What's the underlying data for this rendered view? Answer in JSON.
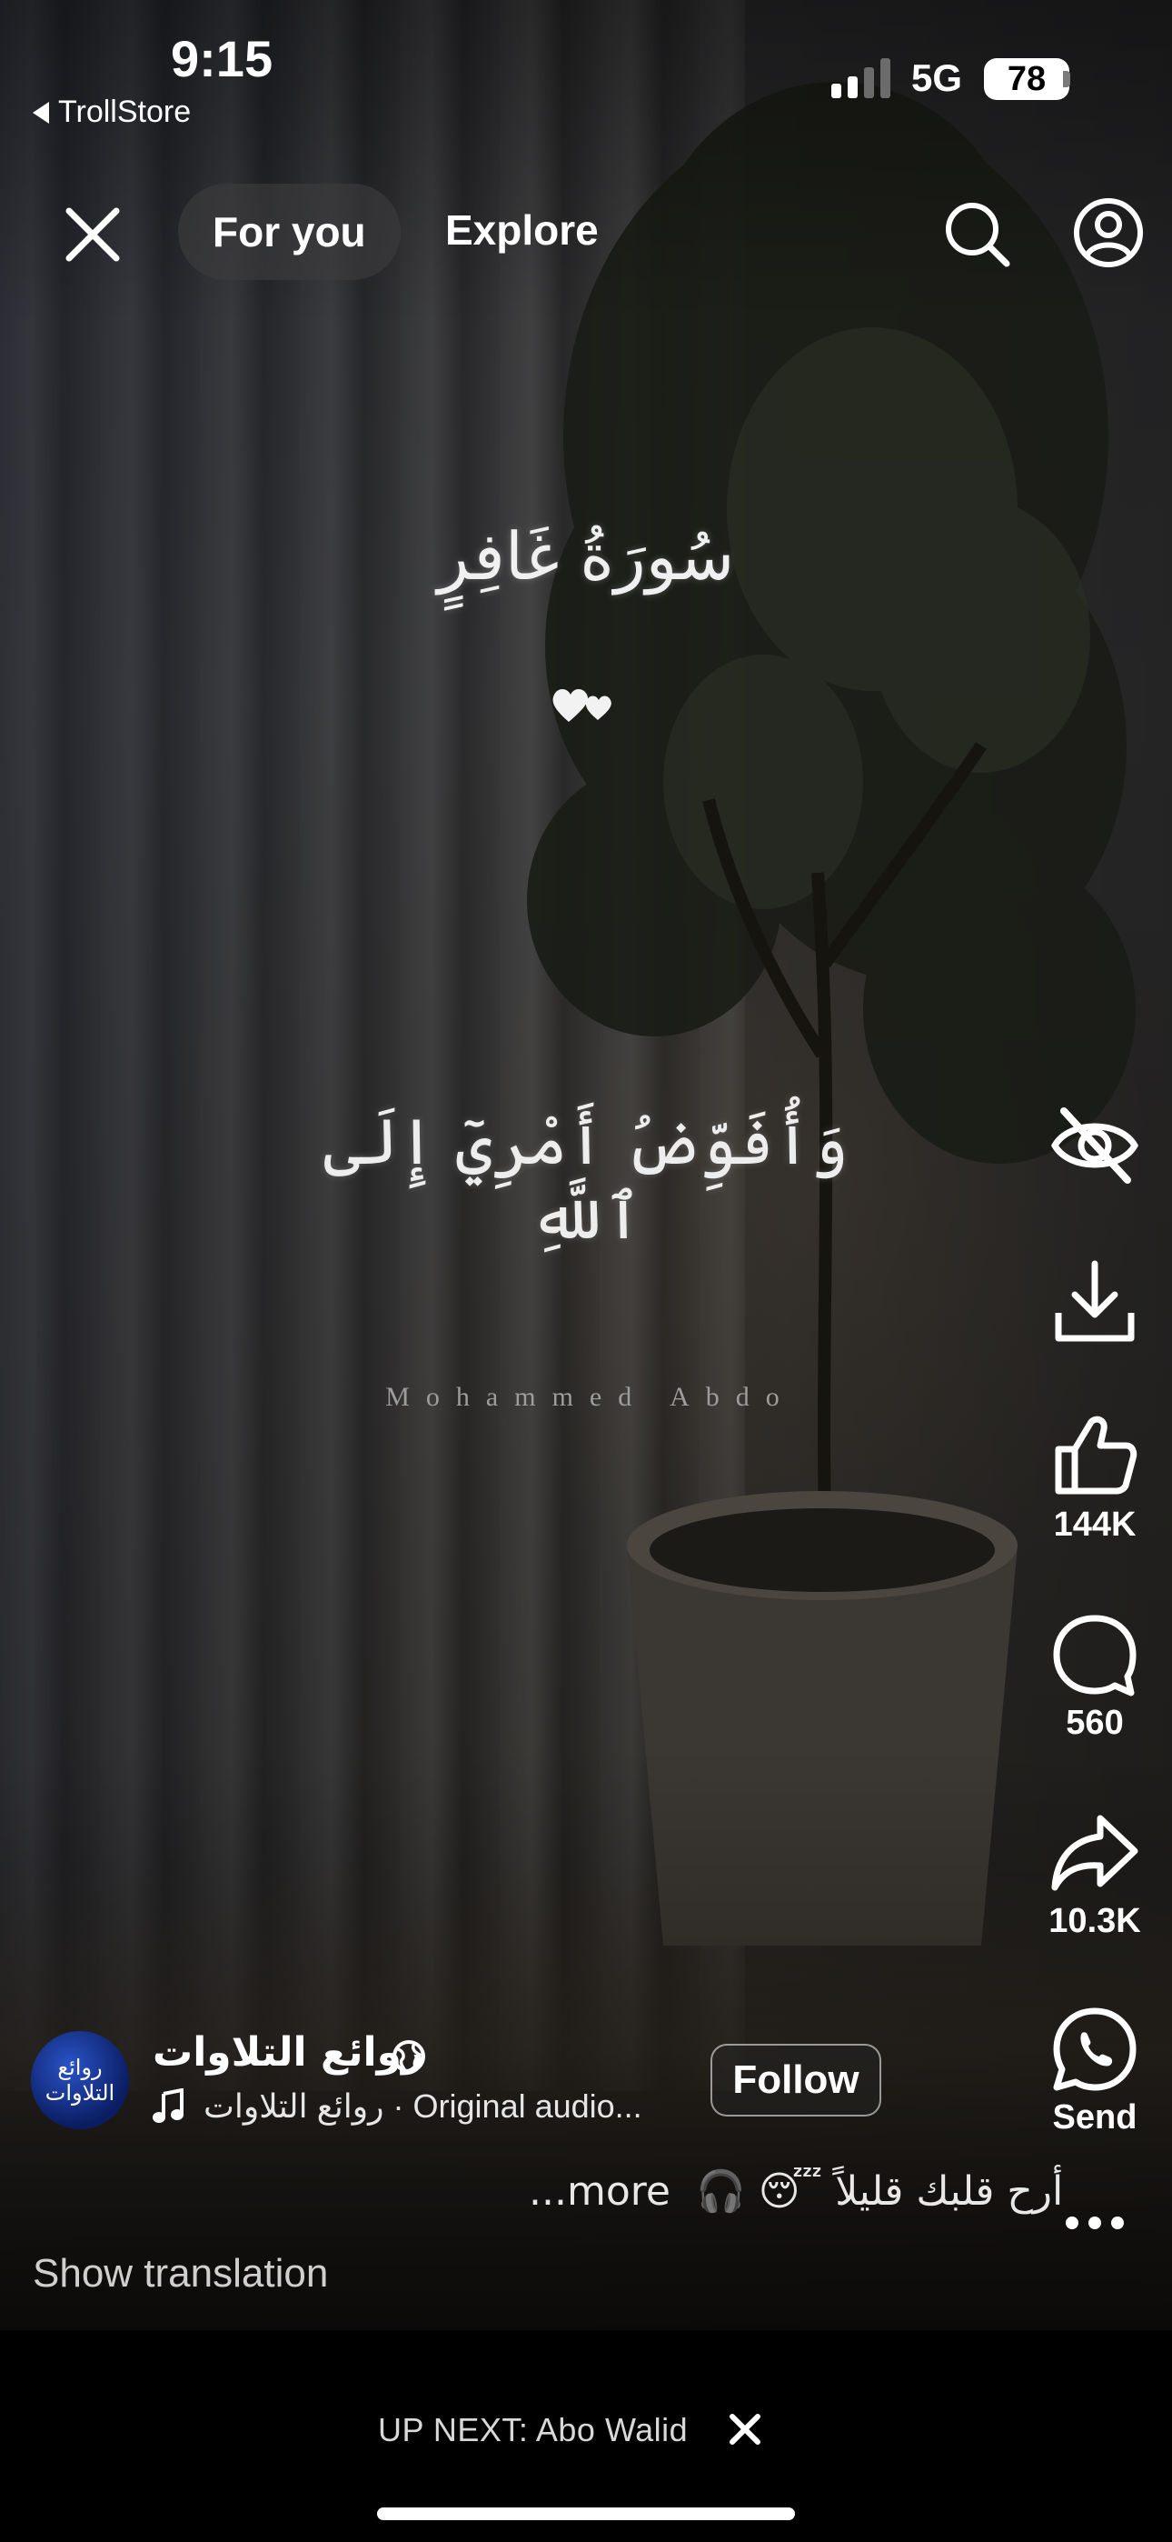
{
  "status_bar": {
    "time": "9:15",
    "back_app": "TrollStore",
    "network": "5G",
    "battery": "78"
  },
  "top_nav": {
    "tabs": [
      {
        "label": "For you",
        "active": true
      },
      {
        "label": "Explore",
        "active": false
      }
    ],
    "icons": [
      "close-icon",
      "search-icon",
      "profile-icon"
    ]
  },
  "video_overlay": {
    "surah_title": "سُورَةُ غَافِرٍ",
    "verse": "وَأُفَوِّضُ أَمْرِيٓ إِلَى ٱللَّهِ",
    "reciter": "Mohammed Abdo"
  },
  "actions": {
    "not_interested_icon": "eye-slash-icon",
    "download_icon": "download-icon",
    "likes": "144K",
    "comments": "560",
    "shares": "10.3K",
    "send_label": "Send"
  },
  "post": {
    "avatar_text": "روائع التلاوات",
    "username": "روائع التلاوات",
    "audio": "روائع التلاوات · Original audio...",
    "follow_label": "Follow",
    "caption_text": "أرح قلبك قليلاً 😴 🎧",
    "more_label": "more...",
    "show_translation": "Show translation"
  },
  "up_next": {
    "label": "UP NEXT: Abo Walid"
  },
  "colors": {
    "background": "#000000",
    "text": "#ffffff",
    "avatar_blue": "#1e3fa8"
  }
}
